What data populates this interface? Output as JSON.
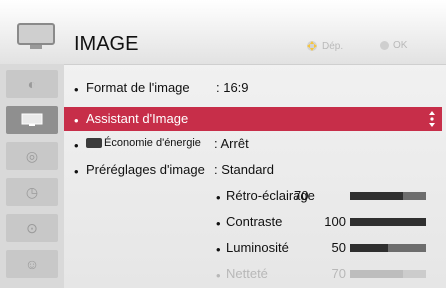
{
  "header": {
    "title": "IMAGE",
    "nav_hint": "Dép.",
    "ok_hint": "OK"
  },
  "sidebar": {
    "items": [
      {
        "icon": "speaker-icon",
        "active": false
      },
      {
        "icon": "tv-picture-icon",
        "active": true
      },
      {
        "icon": "disc-icon",
        "active": false
      },
      {
        "icon": "clock-icon",
        "active": false
      },
      {
        "icon": "lock-icon",
        "active": false
      },
      {
        "icon": "person-icon",
        "active": false
      }
    ]
  },
  "menu": {
    "items": [
      {
        "label": "Format de l'image",
        "value": ": 16:9",
        "selected": false
      },
      {
        "label": "Assistant d'Image",
        "value": "",
        "selected": true
      },
      {
        "label": "Économie d'énergie",
        "value": ": Arrêt",
        "selected": false
      },
      {
        "label": "Préréglages d'image",
        "value": ": Standard",
        "selected": false
      }
    ]
  },
  "settings": [
    {
      "label": "Rétro-éclairage",
      "value": "70",
      "level": 0.7,
      "dim": false
    },
    {
      "label": "Contraste",
      "value": "100",
      "level": 1.0,
      "dim": false
    },
    {
      "label": "Luminosité",
      "value": "50",
      "level": 0.5,
      "dim": false
    },
    {
      "label": "Netteté",
      "value": "70",
      "level": 0.7,
      "dim": true
    }
  ]
}
